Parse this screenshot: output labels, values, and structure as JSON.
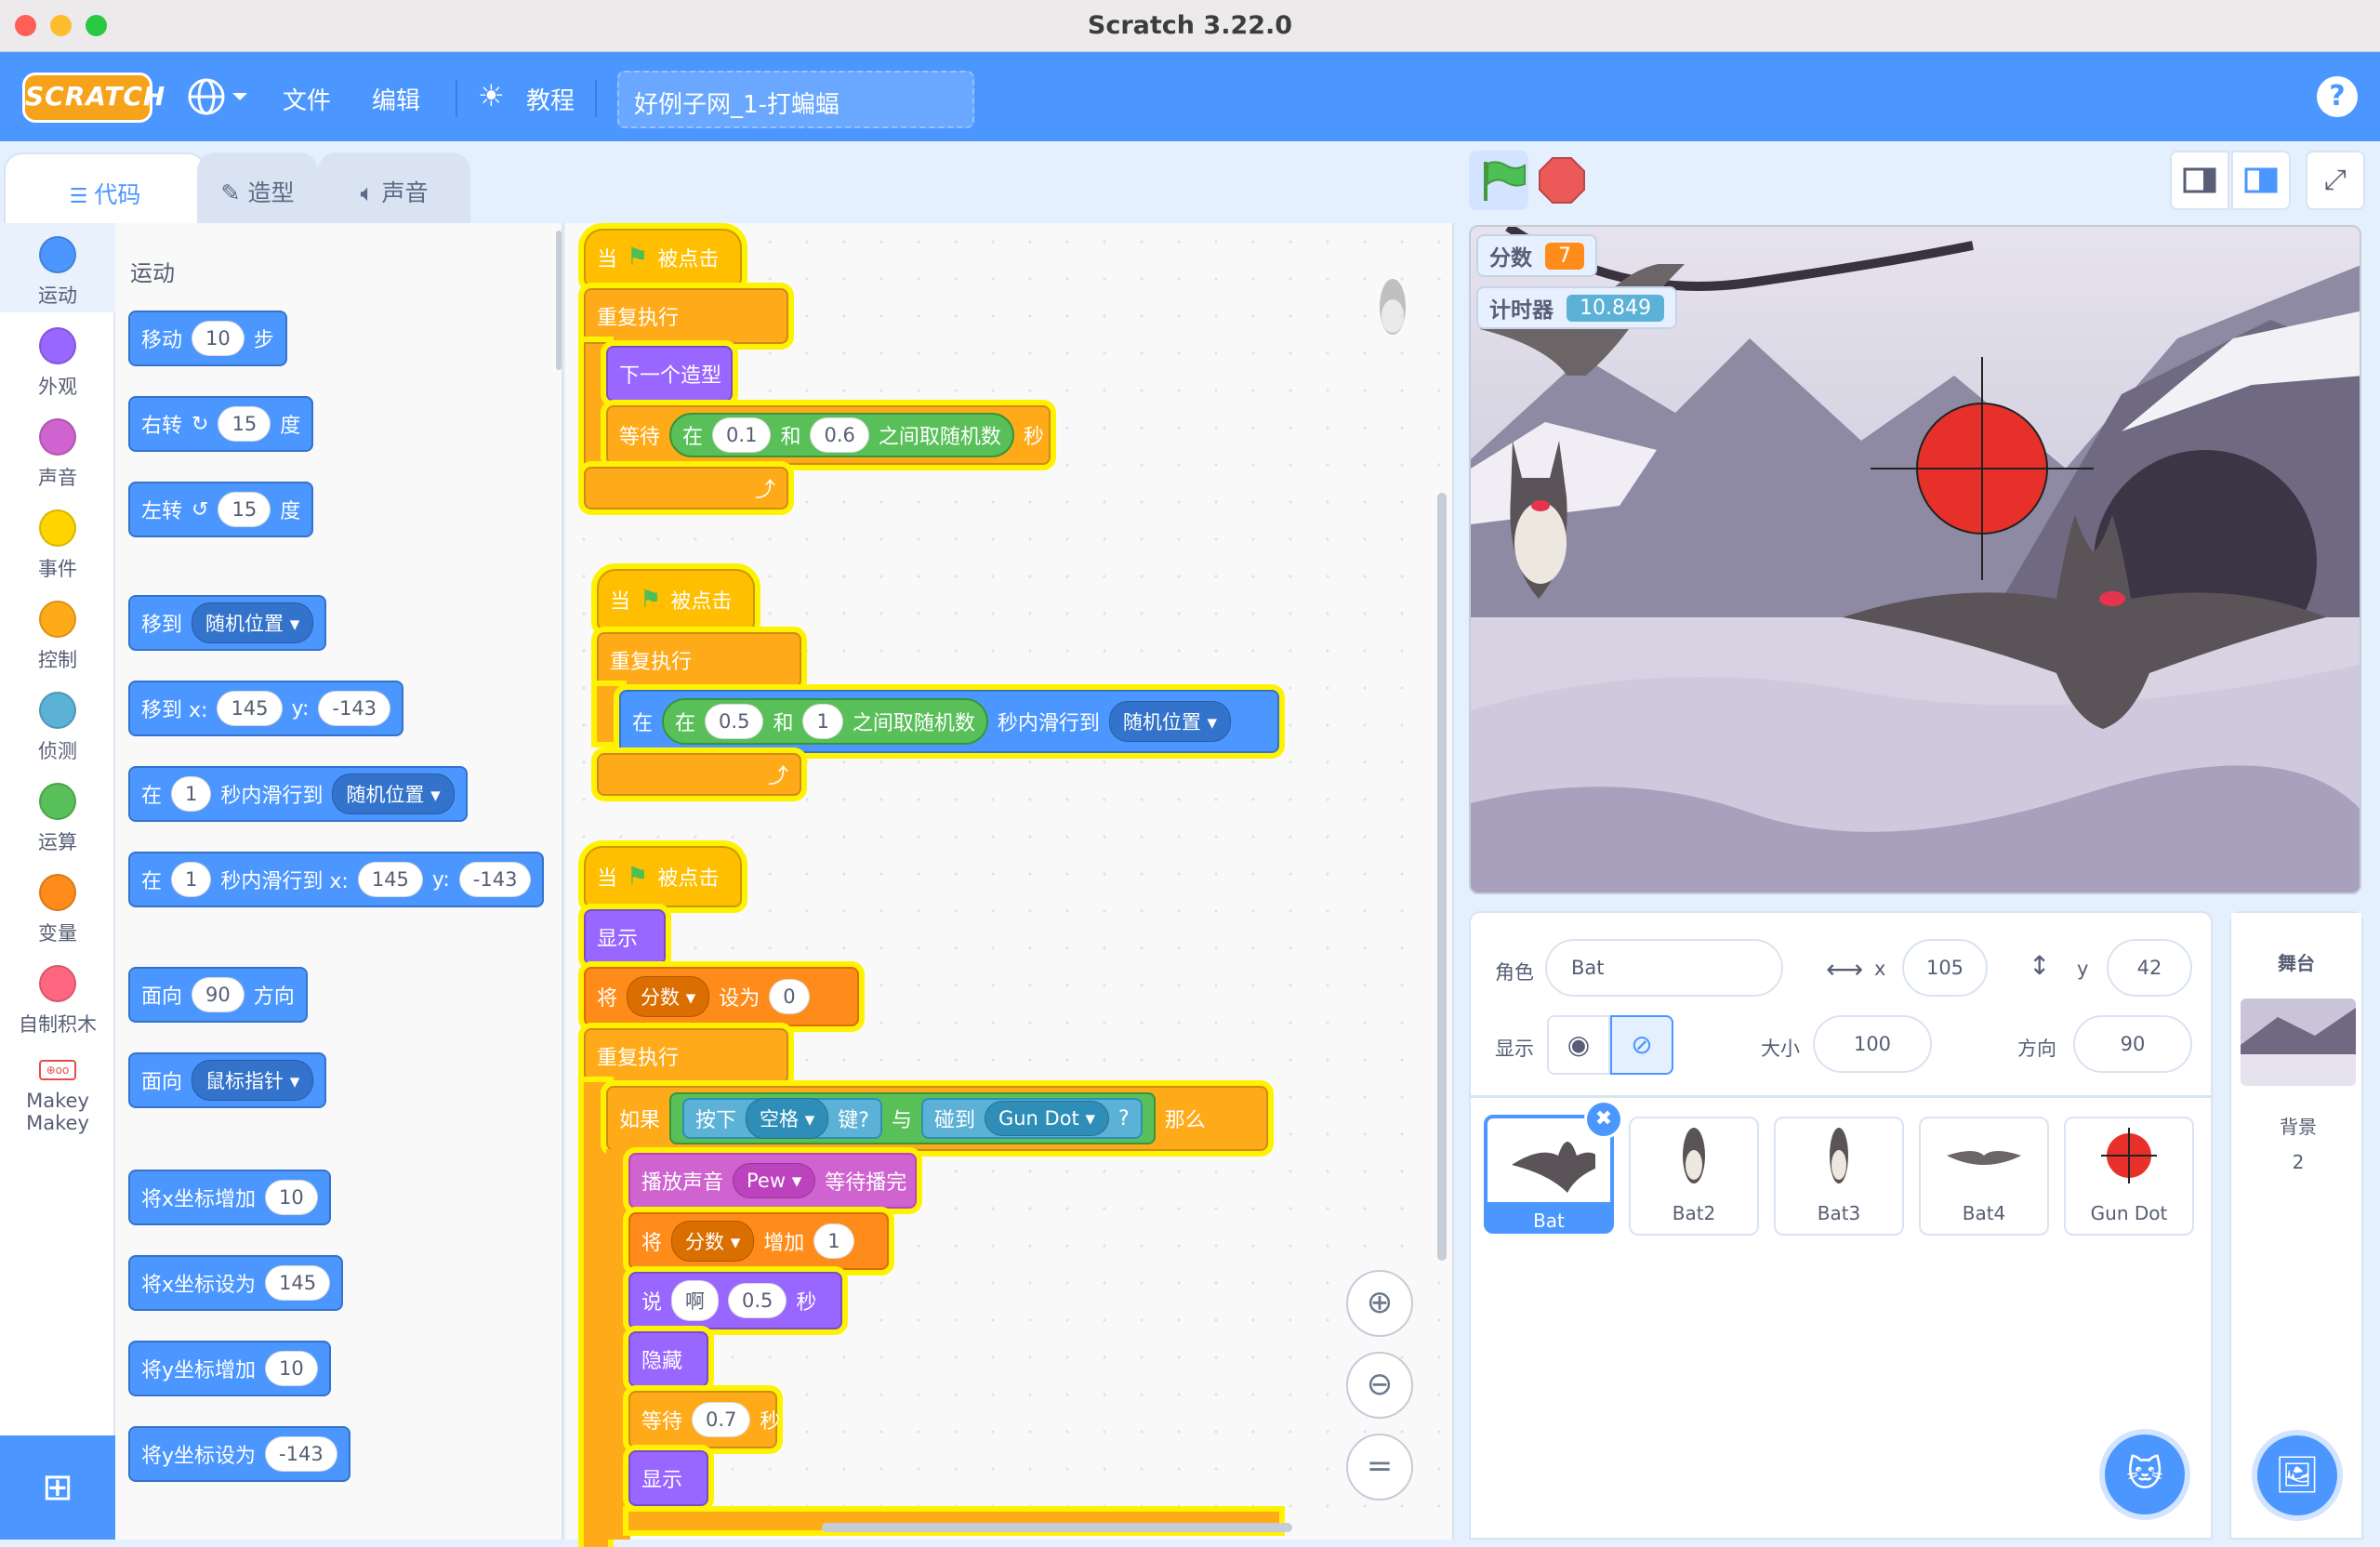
{
  "window": {
    "title": "Scratch 3.22.0"
  },
  "menubar": {
    "logo": "SCRATCH",
    "file": "文件",
    "edit": "编辑",
    "tutorials": "教程",
    "project_title": "好例子网_1-打蝙蝠",
    "help": "?"
  },
  "tabs": {
    "code": "代码",
    "costumes": "造型",
    "sounds": "声音"
  },
  "categories": [
    {
      "label": "运动",
      "color": "#4c97ff"
    },
    {
      "label": "外观",
      "color": "#9966ff"
    },
    {
      "label": "声音",
      "color": "#cf63cf"
    },
    {
      "label": "事件",
      "color": "#ffd500"
    },
    {
      "label": "控制",
      "color": "#ffab19"
    },
    {
      "label": "侦测",
      "color": "#5cb1d6"
    },
    {
      "label": "运算",
      "color": "#59c059"
    },
    {
      "label": "变量",
      "color": "#ff8c1a"
    },
    {
      "label": "自制积木",
      "color": "#ff6680"
    },
    {
      "label": "Makey Makey",
      "color": "#e64d4d"
    }
  ],
  "palette": {
    "heading": "运动",
    "move": {
      "a": "移动",
      "v": "10",
      "b": "步"
    },
    "turn_right": {
      "a": "右转",
      "v": "15",
      "b": "度"
    },
    "turn_left": {
      "a": "左转",
      "v": "15",
      "b": "度"
    },
    "goto": {
      "a": "移到",
      "dd": "随机位置"
    },
    "goto_xy": {
      "a": "移到 x:",
      "x": "145",
      "y_lbl": "y:",
      "y": "-143"
    },
    "glide": {
      "a": "在",
      "v": "1",
      "b": "秒内滑行到",
      "dd": "随机位置"
    },
    "glide_xy": {
      "a": "在",
      "v": "1",
      "b": "秒内滑行到 x:",
      "x": "145",
      "y_lbl": "y:",
      "y": "-143"
    },
    "point_dir": {
      "a": "面向",
      "v": "90",
      "b": "方向"
    },
    "point_towards": {
      "a": "面向",
      "dd": "鼠标指针"
    },
    "change_x": {
      "a": "将x坐标增加",
      "v": "10"
    },
    "set_x": {
      "a": "将x坐标设为",
      "v": "145"
    },
    "change_y": {
      "a": "将y坐标增加",
      "v": "10"
    },
    "set_y": {
      "a": "将y坐标设为",
      "v": "-143"
    }
  },
  "script1": {
    "when": "当",
    "clicked": "被点击",
    "forever": "重复执行",
    "next_costume": "下一个造型",
    "wait": "等待",
    "in": "在",
    "v1": "0.1",
    "and": "和",
    "v2": "0.6",
    "random": "之间取随机数",
    "sec": "秒"
  },
  "script2": {
    "when": "当",
    "clicked": "被点击",
    "forever": "重复执行",
    "glide_in": "在",
    "in": "在",
    "v1": "0.5",
    "and": "和",
    "v2": "1",
    "random": "之间取随机数",
    "glide_to": "秒内滑行到",
    "dd": "随机位置"
  },
  "script3": {
    "when": "当",
    "clicked": "被点击",
    "show": "显示",
    "set": "将",
    "var": "分数",
    "to": "设为",
    "v0": "0",
    "forever": "重复执行",
    "if": "如果",
    "key_press": "按下",
    "key": "空格",
    "key_q": "键?",
    "and": "与",
    "touching": "碰到",
    "gun": "Gun Dot",
    "q": "?",
    "then": "那么",
    "play": "播放声音",
    "sound": "Pew",
    "until_done": "等待播完",
    "change": "将",
    "var2": "分数",
    "by": "增加",
    "v1": "1",
    "say": "说",
    "say_text": "啊",
    "say_sec": "0.5",
    "sec": "秒",
    "hide": "隐藏",
    "wait": "等待",
    "wait_v": "0.7",
    "sec2": "秒",
    "show2": "显示"
  },
  "stage": {
    "score_label": "分数",
    "score": "7",
    "timer_label": "计时器",
    "timer": "10.849"
  },
  "sprite_info": {
    "sprite_label": "角色",
    "sprite_name": "Bat",
    "x_label": "x",
    "x": "105",
    "y_label": "y",
    "y": "42",
    "show_label": "显示",
    "size_label": "大小",
    "size": "100",
    "dir_label": "方向",
    "dir": "90"
  },
  "sprites": [
    {
      "name": "Bat",
      "selected": true
    },
    {
      "name": "Bat2",
      "selected": false
    },
    {
      "name": "Bat3",
      "selected": false
    },
    {
      "name": "Bat4",
      "selected": false
    },
    {
      "name": "Gun Dot",
      "selected": false
    }
  ],
  "stage_panel": {
    "title": "舞台",
    "backdrops_label": "背景",
    "backdrops_count": "2"
  }
}
